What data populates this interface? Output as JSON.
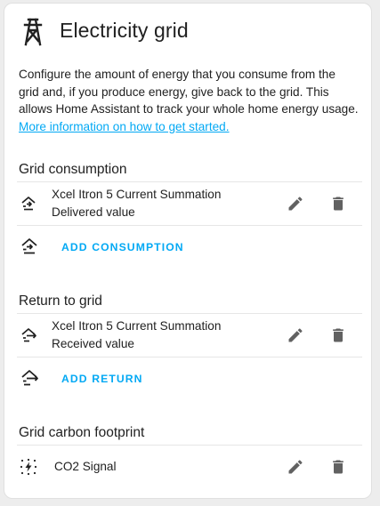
{
  "header": {
    "title": "Electricity grid",
    "icon": "transmission-tower-icon"
  },
  "description": {
    "text": "Configure the amount of energy that you consume from the grid and, if you produce energy, give back to the grid. This allows Home Assistant to track your whole home energy usage. ",
    "link_text": "More information on how to get started."
  },
  "grid_consumption": {
    "title": "Grid consumption",
    "items": [
      {
        "line1": "Xcel Itron 5 Current Summation",
        "line2": "Delivered value",
        "icon": "transmission-tower-import-icon"
      }
    ],
    "add_label": "ADD CONSUMPTION"
  },
  "return_to_grid": {
    "title": "Return to grid",
    "items": [
      {
        "line1": "Xcel Itron 5 Current Summation",
        "line2": "Received value",
        "icon": "transmission-tower-export-icon"
      }
    ],
    "add_label": "ADD RETURN"
  },
  "carbon_footprint": {
    "title": "Grid carbon footprint",
    "items": [
      {
        "label": "CO2 Signal",
        "icon": "co2-signal-icon"
      }
    ]
  },
  "colors": {
    "accent": "#03a9f4",
    "text": "#212121",
    "icon": "#616161",
    "background": "#ededed",
    "card": "#ffffff"
  }
}
